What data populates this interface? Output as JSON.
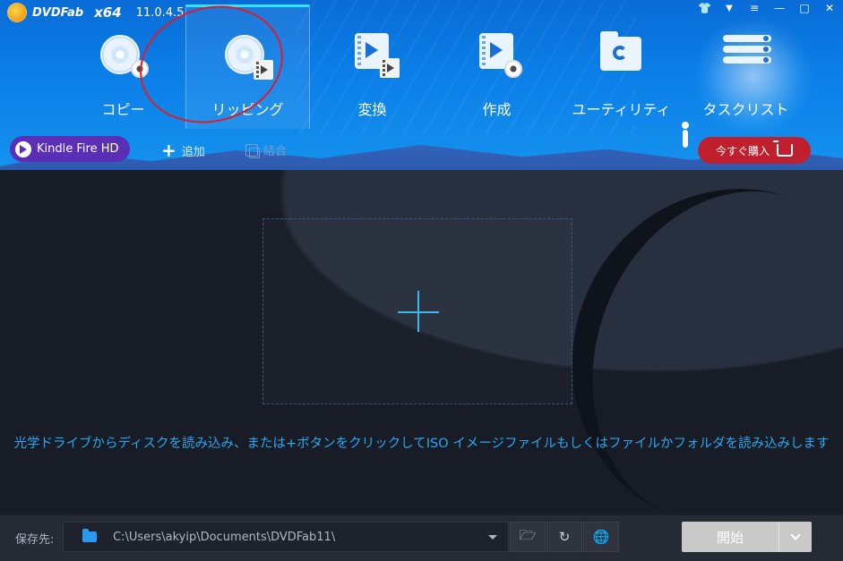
{
  "app": {
    "logo_text": "DVDFab",
    "arch": "x64",
    "version": "11.0.4.5"
  },
  "window_controls": [
    "shirt-icon",
    "heart-icon",
    "menu-icon",
    "minimize",
    "maximize",
    "close"
  ],
  "tabs": [
    {
      "label": "コピー",
      "icon": "copy-disc-icon",
      "active": false
    },
    {
      "label": "リッピング",
      "icon": "ripper-disc-icon",
      "active": true
    },
    {
      "label": "変換",
      "icon": "converter-icon",
      "active": false
    },
    {
      "label": "作成",
      "icon": "creator-icon",
      "active": false
    },
    {
      "label": "ユーティリティ",
      "icon": "utility-folder-icon",
      "active": false
    },
    {
      "label": "タスクリスト",
      "icon": "task-list-icon",
      "active": false
    }
  ],
  "toolbar": {
    "device": "Kindle Fire HD",
    "add_label": "追加",
    "merge_label": "結合",
    "buy_label": "今すぐ購入"
  },
  "main": {
    "hint": "光学ドライブからディスクを読み込み、または+ボタンをクリックしてISO イメージファイルもしくはファイルかフォルダを読み込みします"
  },
  "footer": {
    "save_to_label": "保存先:",
    "path": "C:\\Users\\akyip\\Documents\\DVDFab11\\",
    "start_label": "開始"
  },
  "colors": {
    "header_blue": "#0b7fe8",
    "active_tab_accent": "#2ee6ff",
    "device_purple": "#5a2fb6",
    "buy_red": "#c0202d",
    "hint_blue": "#2aa8ee",
    "annotation_red": "#e01c2a"
  }
}
